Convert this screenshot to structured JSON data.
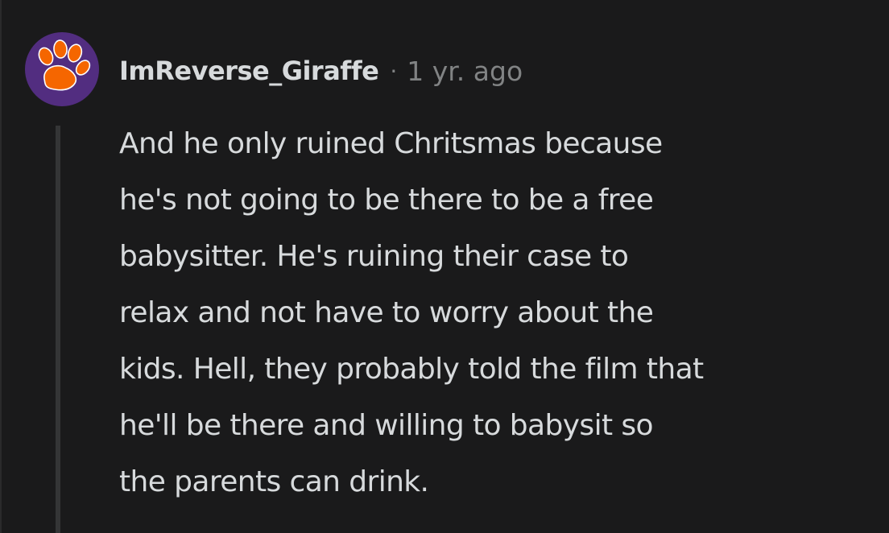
{
  "comment": {
    "author": "ImReverse_Giraffe",
    "separator": "·",
    "timestamp": "1 yr. ago",
    "avatar_icon": "paw-print-icon",
    "colors": {
      "background": "#1a1a1b",
      "text": "#d7dadc",
      "muted": "#818384",
      "thread_line": "#343536",
      "avatar_bg": "#522d80",
      "avatar_paw": "#f56600"
    },
    "body": "And he only ruined Chritsmas because\nhe's not going to be there to be a free\nbabysitter. He's ruining their case to\nrelax and not have to worry about the\nkids. Hell, they probably told the film that\nhe'll be there and willing to babysit so\nthe parents can drink."
  }
}
